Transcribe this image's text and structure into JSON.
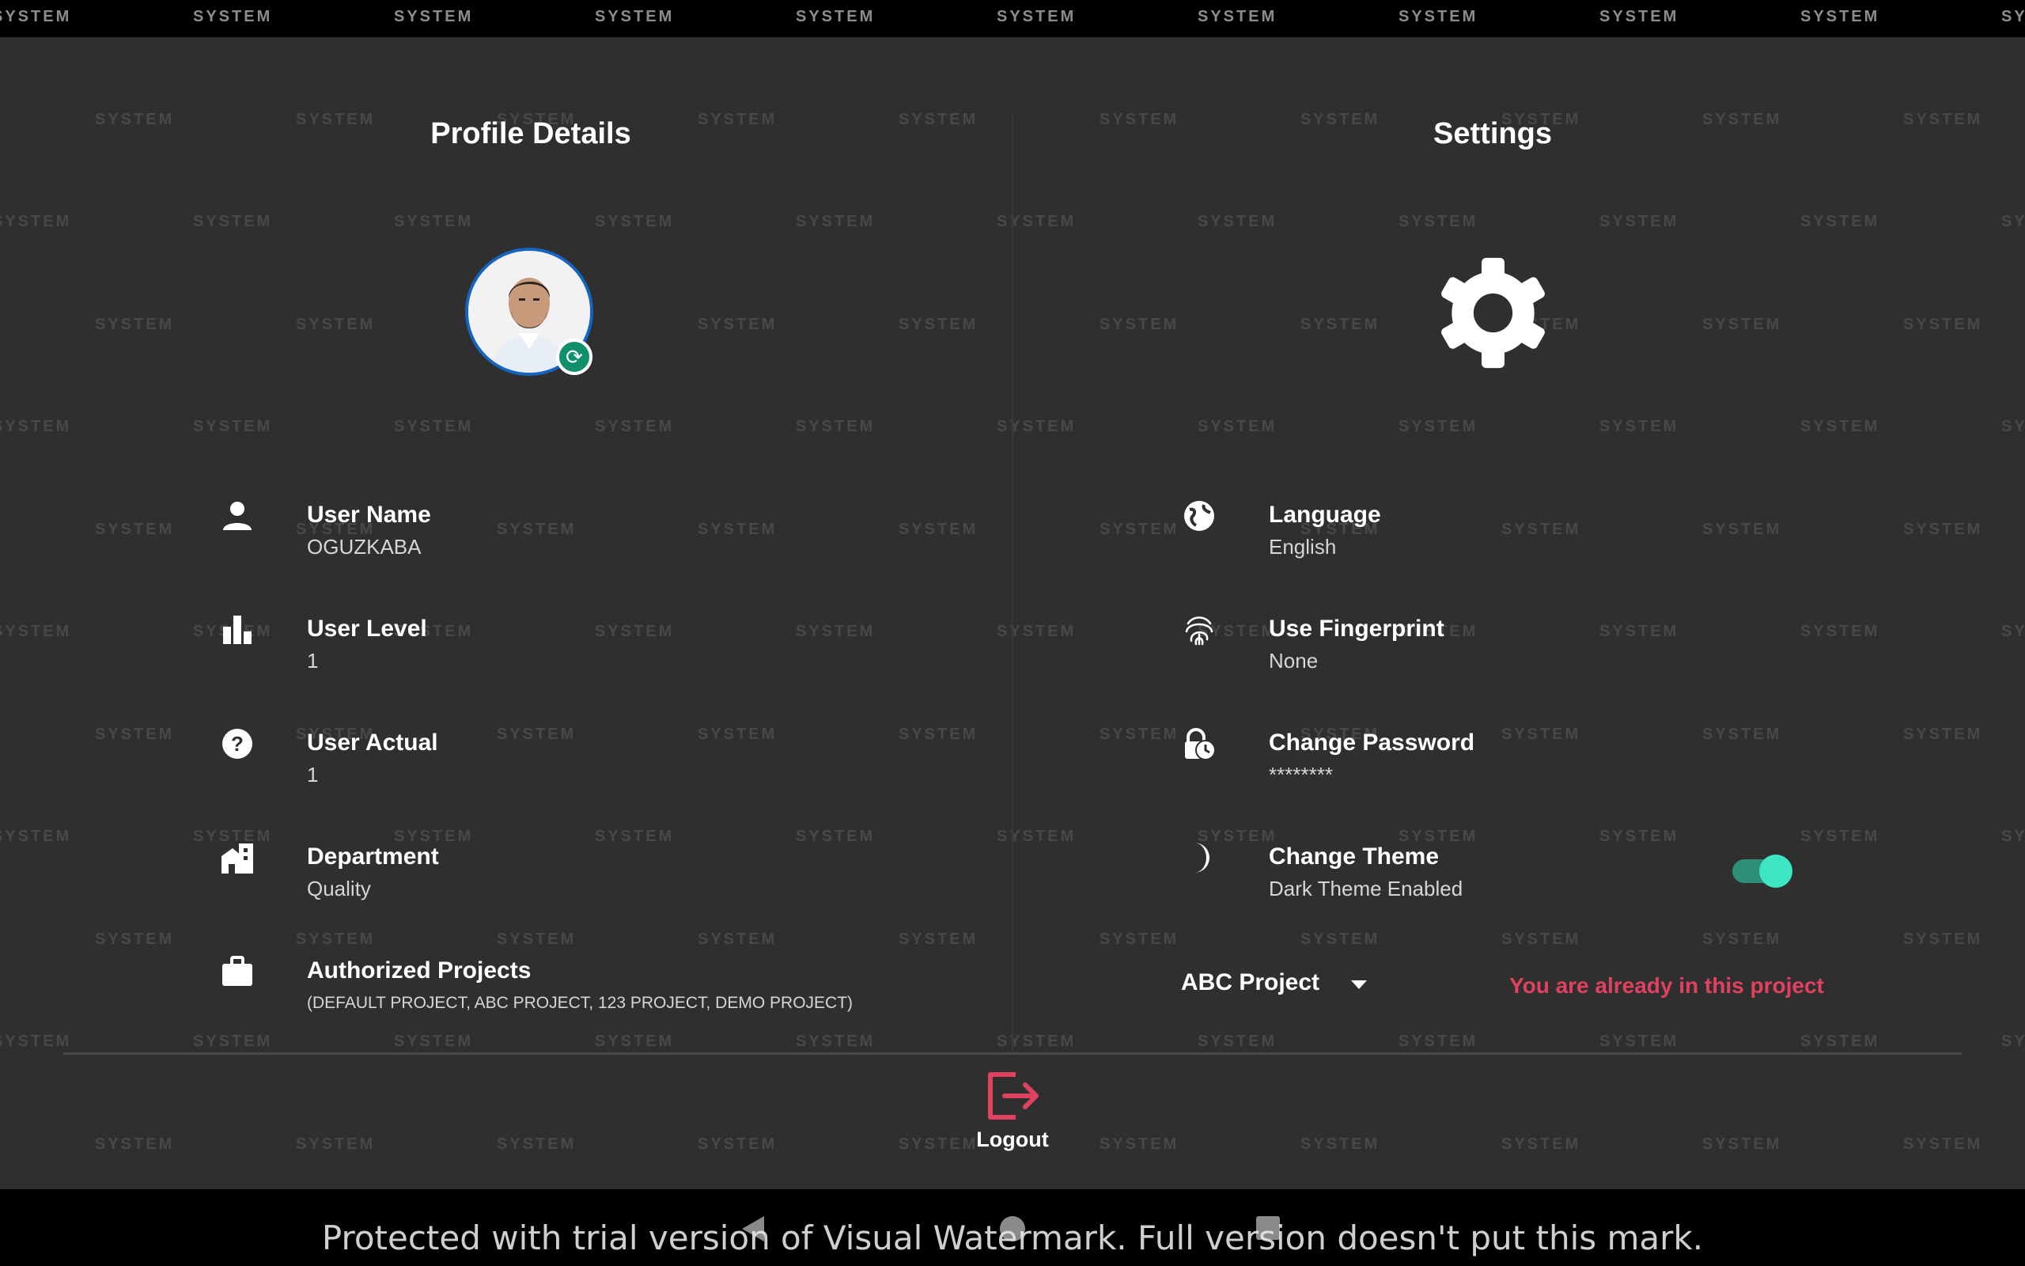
{
  "watermark": {
    "brand": "SYSTEM",
    "notice": "Protected with trial version of Visual Watermark. Full version doesn't put this mark."
  },
  "profile": {
    "title": "Profile Details",
    "fields": [
      {
        "label": "User Name",
        "value": "OGUZKABA",
        "icon": "person-icon"
      },
      {
        "label": "User Level",
        "value": "1",
        "icon": "bar-chart-icon"
      },
      {
        "label": "User Actual",
        "value": "1",
        "icon": "help-circle-icon"
      },
      {
        "label": "Department",
        "value": "Quality",
        "icon": "building-icon"
      },
      {
        "label": "Authorized Projects",
        "value": "(DEFAULT PROJECT, ABC PROJECT, 123 PROJECT, DEMO PROJECT)",
        "icon": "briefcase-icon"
      }
    ]
  },
  "settings": {
    "title": "Settings",
    "fields": [
      {
        "label": "Language",
        "value": "English",
        "icon": "globe-icon"
      },
      {
        "label": "Use Fingerprint",
        "value": "None",
        "icon": "fingerprint-icon"
      },
      {
        "label": "Change Password",
        "value": "********",
        "icon": "lock-clock-icon"
      },
      {
        "label": "Change Theme",
        "value": "Dark Theme Enabled",
        "icon": "moon-icon"
      }
    ],
    "theme_toggle_on": true,
    "project_select": "ABC Project",
    "project_note": "You are already in this project"
  },
  "logout": {
    "label": "Logout"
  },
  "colors": {
    "background": "#2f2f2f",
    "accent_red": "#e0415f",
    "toggle": "#3ee6c4",
    "avatar_ring": "#1565c0",
    "badge": "#0f8f6a"
  }
}
